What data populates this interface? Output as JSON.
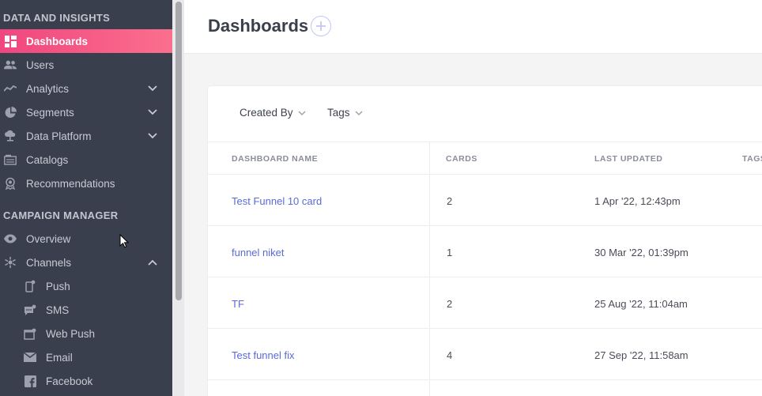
{
  "sidebar": {
    "section1": "DATA AND INSIGHTS",
    "section2": "CAMPAIGN MANAGER",
    "items": [
      {
        "label": "Dashboards",
        "icon": "dashboard-icon"
      },
      {
        "label": "Users",
        "icon": "users-icon"
      },
      {
        "label": "Analytics",
        "icon": "analytics-icon"
      },
      {
        "label": "Segments",
        "icon": "pie-chart-icon"
      },
      {
        "label": "Data Platform",
        "icon": "cloud-icon"
      },
      {
        "label": "Catalogs",
        "icon": "catalog-icon"
      },
      {
        "label": "Recommendations",
        "icon": "award-icon"
      },
      {
        "label": "Overview",
        "icon": "eye-icon"
      },
      {
        "label": "Channels",
        "icon": "channels-icon"
      },
      {
        "label": "Push",
        "icon": "phone-icon"
      },
      {
        "label": "SMS",
        "icon": "sms-icon"
      },
      {
        "label": "Web Push",
        "icon": "web-push-icon"
      },
      {
        "label": "Email",
        "icon": "mail-icon"
      },
      {
        "label": "Facebook",
        "icon": "facebook-icon"
      }
    ]
  },
  "header": {
    "title": "Dashboards"
  },
  "filters": {
    "created_by": "Created By",
    "tags": "Tags"
  },
  "table": {
    "columns": [
      "DASHBOARD NAME",
      "CARDS",
      "LAST UPDATED",
      "TAGS"
    ],
    "rows": [
      {
        "name": "Test Funnel 10 card",
        "cards": "2",
        "updated": "1 Apr '22, 12:43pm"
      },
      {
        "name": "funnel niket",
        "cards": "1",
        "updated": "30 Mar '22, 01:39pm"
      },
      {
        "name": "TF",
        "cards": "2",
        "updated": "25 Aug '22, 11:04am"
      },
      {
        "name": "Test funnel fix",
        "cards": "4",
        "updated": "27 Sep '22, 11:58am"
      }
    ]
  },
  "colors": {
    "accent_start": "#f0467f",
    "accent_end": "#fb6f8d",
    "link": "#5a6ad8",
    "sidebar_bg": "#3a3f4e"
  }
}
